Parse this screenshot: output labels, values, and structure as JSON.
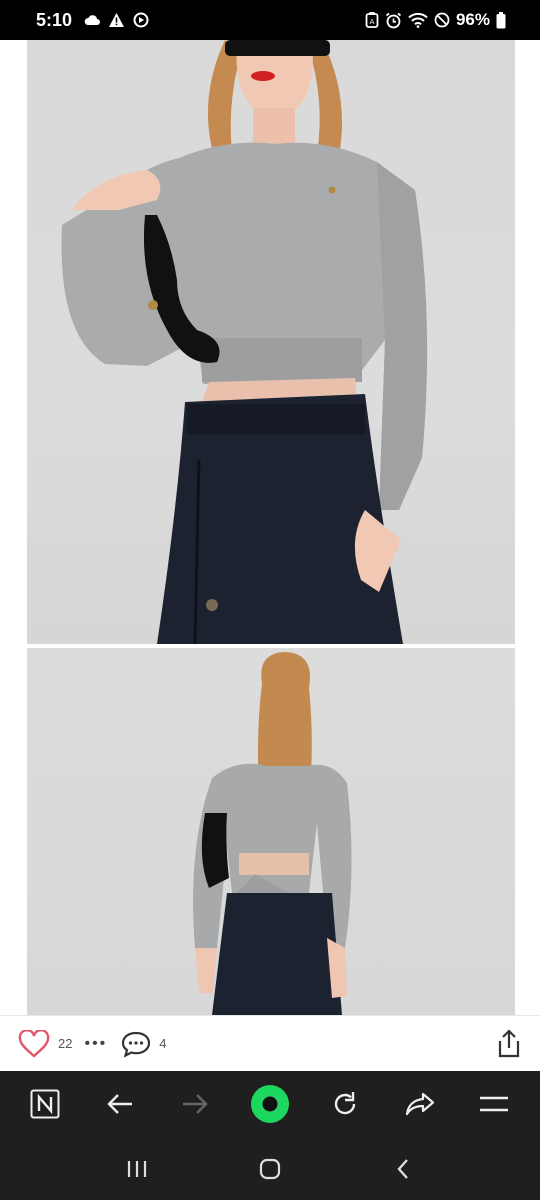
{
  "status_bar": {
    "time": "5:10",
    "battery": "96%"
  },
  "post": {
    "likes": "22",
    "comments": "4",
    "more": "•••"
  },
  "colors": {
    "heart": "#e0566b",
    "accent": "#1ed760",
    "browser_bg": "#1f1f1f"
  },
  "icons": {
    "status": [
      "cloud-icon",
      "warning-icon",
      "sync-icon",
      "alarm-icon",
      "wifi-icon",
      "dnd-icon",
      "battery-icon"
    ],
    "browser": [
      "naver-icon",
      "back-arrow-icon",
      "forward-arrow-icon",
      "home-record-icon",
      "refresh-icon",
      "share-arrow-icon",
      "menu-icon"
    ],
    "system": [
      "recents-icon",
      "home-icon",
      "back-icon"
    ]
  }
}
